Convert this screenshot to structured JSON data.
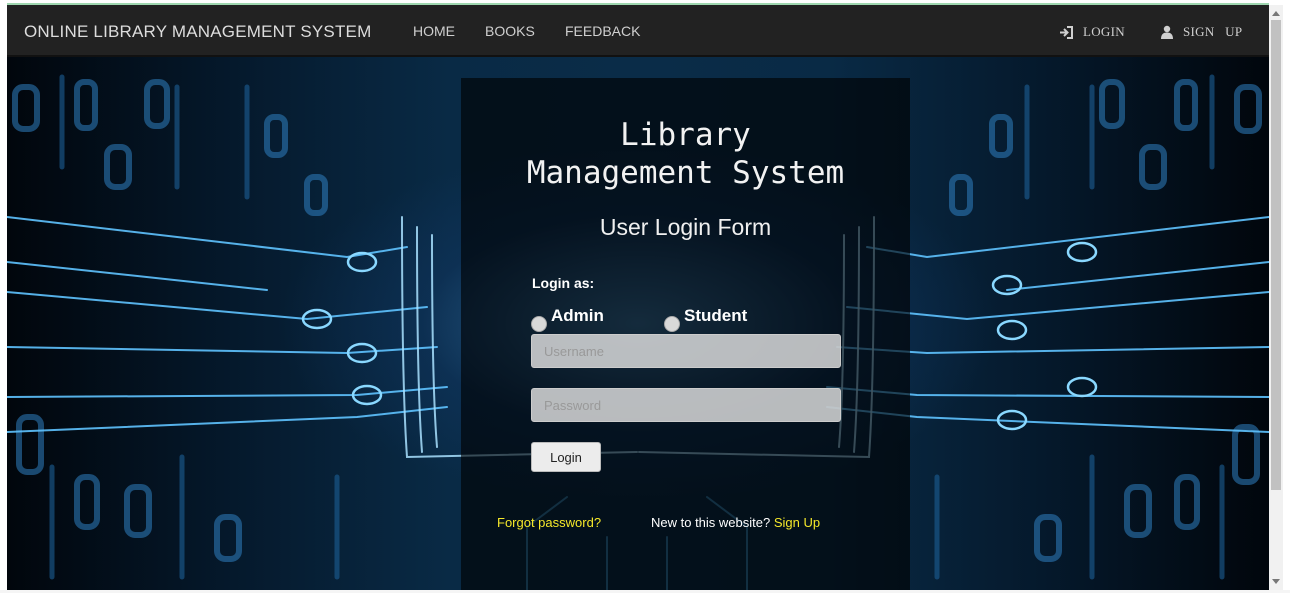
{
  "nav": {
    "brand": "ONLINE LIBRARY MANAGEMENT SYSTEM",
    "links": [
      "HOME",
      "BOOKS",
      "FEEDBACK"
    ],
    "login": "LOGIN",
    "signup": "SIGN   UP",
    "login_icon": "login-arrow-icon",
    "signup_icon": "user-icon"
  },
  "form": {
    "title": "Library Management System",
    "subtitle": "User Login Form",
    "login_as": "Login as:",
    "roles": [
      "Admin",
      "Student"
    ],
    "username_placeholder": "Username",
    "password_placeholder": "Password",
    "login_button": "Login",
    "forgot": "Forgot password?",
    "new_user": "New to this website?",
    "signup_link": "Sign Up"
  },
  "colors": {
    "navbar_bg": "#222222",
    "link_yellow": "#f5e82a",
    "panel_bg": "rgba(0,0,0,0.62)"
  }
}
